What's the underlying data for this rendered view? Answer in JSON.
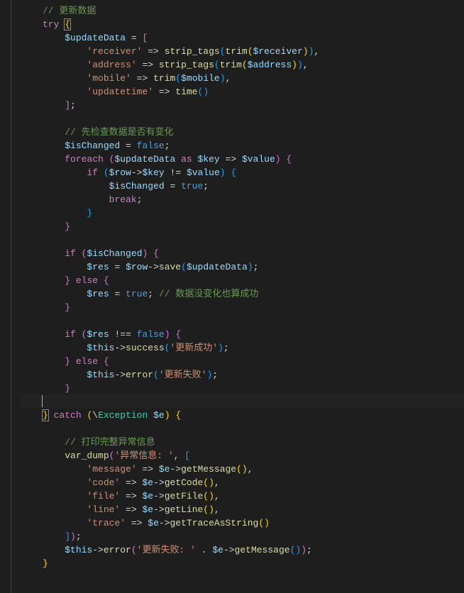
{
  "code": {
    "comment_update": "// 更新数据",
    "kw_try": "try",
    "var_updateData": "$updateData",
    "str_receiver": "'receiver'",
    "fn_strip_tags": "strip_tags",
    "fn_trim": "trim",
    "var_receiver": "$receiver",
    "str_address": "'address'",
    "var_address": "$address",
    "str_mobile": "'mobile'",
    "var_mobile": "$mobile",
    "str_updatetime": "'updatetime'",
    "fn_time": "time",
    "comment_check": "// 先检查数据是否有变化",
    "var_isChanged": "$isChanged",
    "kw_false": "false",
    "kw_true": "true",
    "kw_foreach": "foreach",
    "kw_as": "as",
    "var_key": "$key",
    "var_value": "$value",
    "kw_if": "if",
    "var_row": "$row",
    "kw_break": "break",
    "kw_else": "else",
    "var_res": "$res",
    "fn_save": "save",
    "comment_nochange": "// 数据没变化也算成功",
    "var_this": "$this",
    "fn_success": "success",
    "str_update_ok": "'更新成功'",
    "fn_error": "error",
    "str_update_fail": "'更新失败'",
    "kw_catch": "catch",
    "cls_exception": "Exception",
    "var_e": "$e",
    "comment_print": "// 打印完整异常信息",
    "fn_vardump": "var_dump",
    "str_exc_info": "'异常信息: '",
    "str_message": "'message'",
    "fn_getMessage": "getMessage",
    "str_code": "'code'",
    "fn_getCode": "getCode",
    "str_file": "'file'",
    "fn_getFile": "getFile",
    "str_line": "'line'",
    "fn_getLine": "getLine",
    "str_trace": "'trace'",
    "fn_getTraceAsString": "getTraceAsString",
    "str_update_fail_colon": "'更新失败: '"
  }
}
